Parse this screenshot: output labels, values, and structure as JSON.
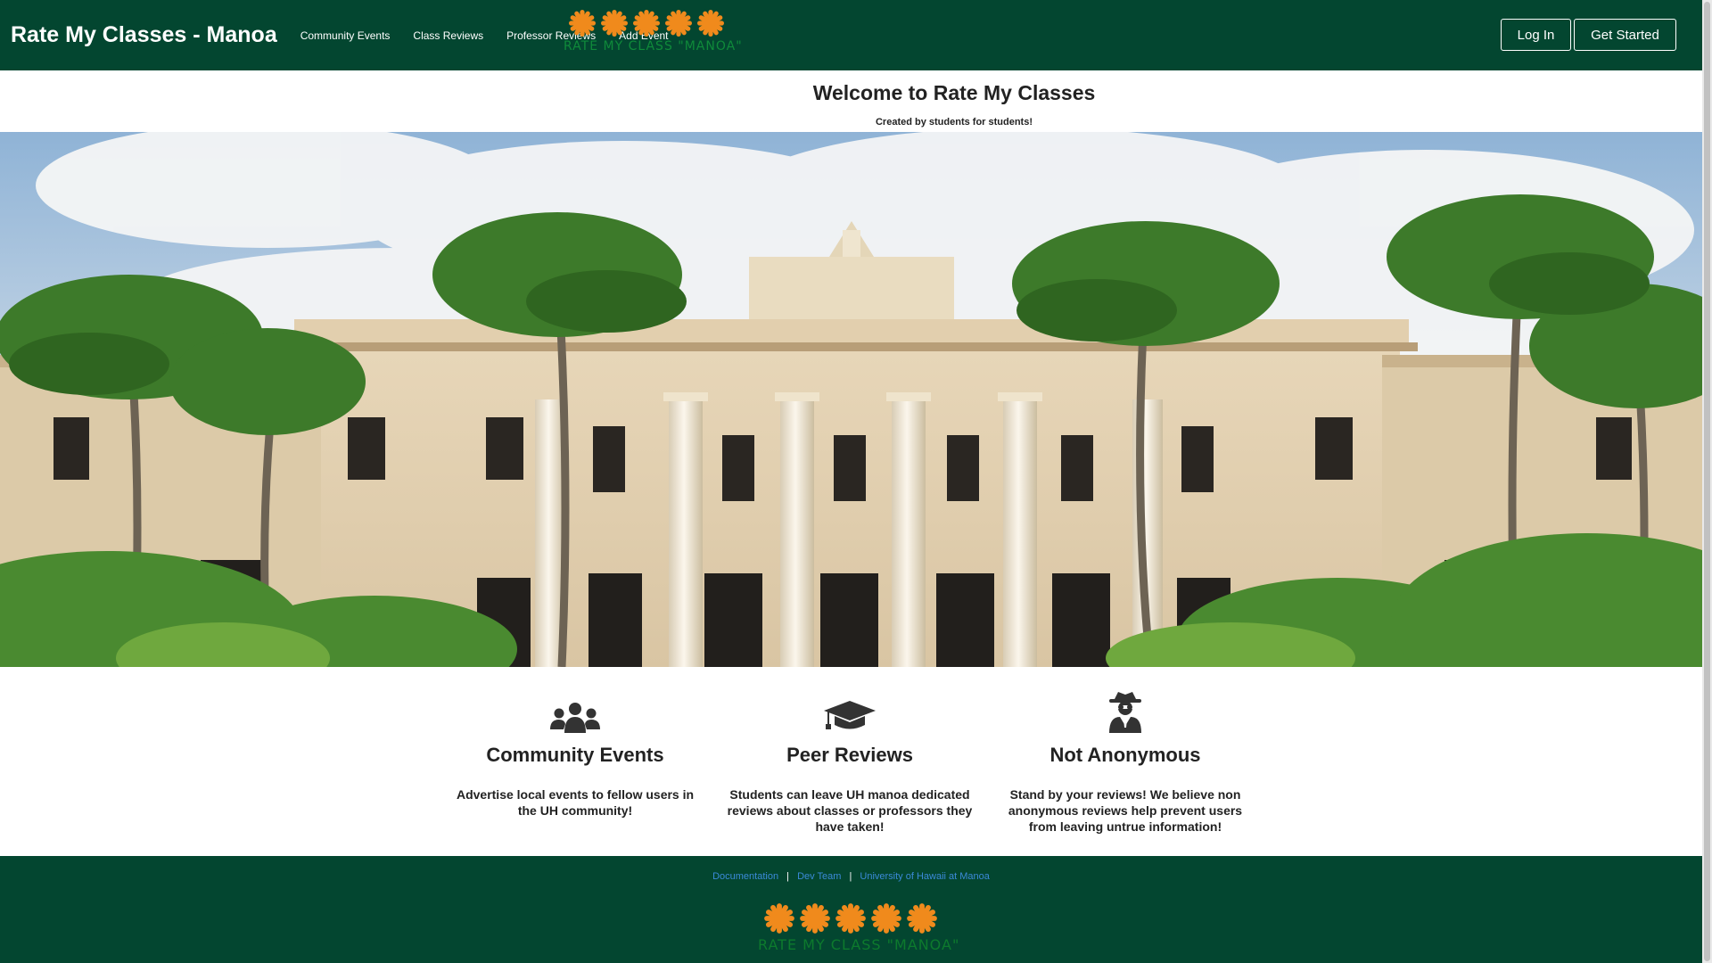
{
  "navbar": {
    "brand": "Rate My Classes - Manoa",
    "links": [
      "Community Events",
      "Class Reviews",
      "Professor Reviews",
      "Add Event"
    ],
    "login_label": "Log In",
    "get_started_label": "Get Started"
  },
  "header": {
    "logo_text": "RATE MY CLASS \"MANOA\"",
    "title": "Welcome to Rate My Classes",
    "subtitle": "Created by students for students!"
  },
  "features": [
    {
      "icon": "users-icon",
      "title": "Community Events",
      "text": "Advertise local events to fellow users in the UH community!"
    },
    {
      "icon": "graduation-cap-icon",
      "title": "Peer Reviews",
      "text": "Students can leave UH manoa dedicated reviews about classes or professors they have taken!"
    },
    {
      "icon": "user-secret-icon",
      "title": "Not Anonymous",
      "text": "Stand by your reviews! We believe non anonymous reviews help prevent users from leaving untrue information!"
    }
  ],
  "footer": {
    "links": [
      "Documentation",
      "Dev Team",
      "University of Hawaii at Manoa"
    ],
    "separator": "|",
    "logo_text": "RATE MY CLASS \"MANOA\""
  },
  "colors": {
    "navbar_bg": "#034630",
    "star_orange": "#f08a1c",
    "logo_green": "#0f8a3a",
    "footer_link": "#3b8ad8"
  }
}
